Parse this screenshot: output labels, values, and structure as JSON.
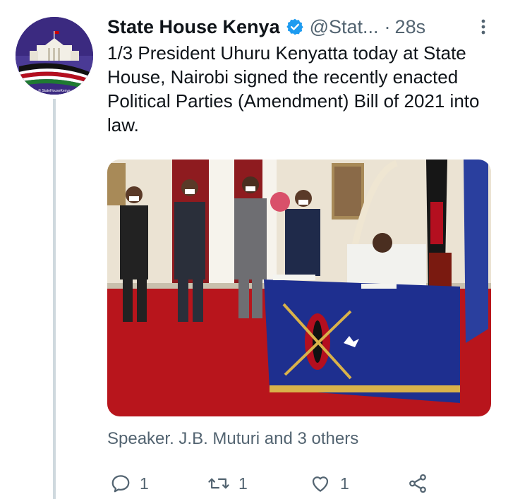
{
  "tweet": {
    "author_name": "State House Kenya",
    "handle": "@Stat...",
    "separator": "·",
    "timestamp": "28s",
    "text": "1/3 President Uhuru Kenyatta today at State House, Nairobi signed the recently enacted Political Parties (Amendment) Bill of 2021 into law.",
    "tagged_people": "Speaker. J.B. Muturi and 3 others",
    "avatar_caption": "© StateHouseKenya"
  },
  "actions": {
    "reply_count": "1",
    "retweet_count": "1",
    "like_count": "1"
  },
  "colors": {
    "text": "#0f1419",
    "secondary": "#536471",
    "verified": "#1d9bf0",
    "thread_line": "#cfd9de"
  }
}
